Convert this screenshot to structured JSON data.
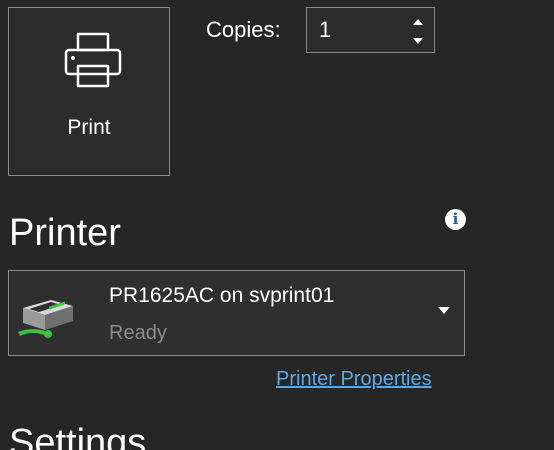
{
  "print": {
    "label": "Print",
    "icon": "printer-icon"
  },
  "copies": {
    "label": "Copies:",
    "value": "1"
  },
  "printer": {
    "heading": "Printer",
    "info_icon": "info-icon",
    "name": "PR1625AC on svprint01",
    "status": "Ready",
    "device_icon": "network-printer-icon",
    "properties_link": "Printer Properties"
  },
  "settings": {
    "heading": "Settings"
  },
  "colors": {
    "background": "#262626",
    "border": "#8a8a8a",
    "link": "#5aa9e6",
    "muted_text": "#8c8c8c",
    "info_icon_fg": "#2b579a"
  }
}
